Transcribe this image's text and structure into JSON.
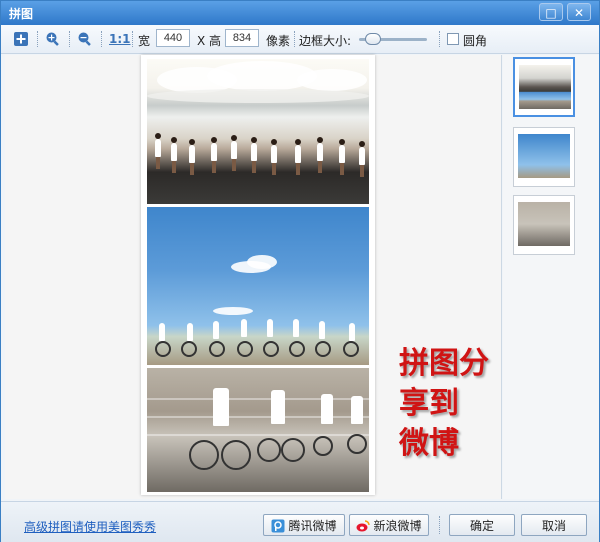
{
  "window": {
    "title": "拼图"
  },
  "toolbar": {
    "actual_size_label": "1:1",
    "width_label": "宽",
    "width_value": "440",
    "height_label": "X 高",
    "height_value": "834",
    "unit_label": "像素",
    "border_label": "边框大小:",
    "border_slider_level": 0.2,
    "rounded_label": "圆角",
    "rounded_checked": false
  },
  "overlay": {
    "line1": "拼图分享到",
    "line2": "微博"
  },
  "footer": {
    "link_text": "高级拼图请使用美图秀秀",
    "share_tencent": "腾讯微博",
    "share_sina": "新浪微博",
    "ok": "确定",
    "cancel": "取消"
  },
  "colors": {
    "titlebar": "#2f78c9",
    "overlay_text": "#d01414",
    "link": "#1f5fbf"
  }
}
